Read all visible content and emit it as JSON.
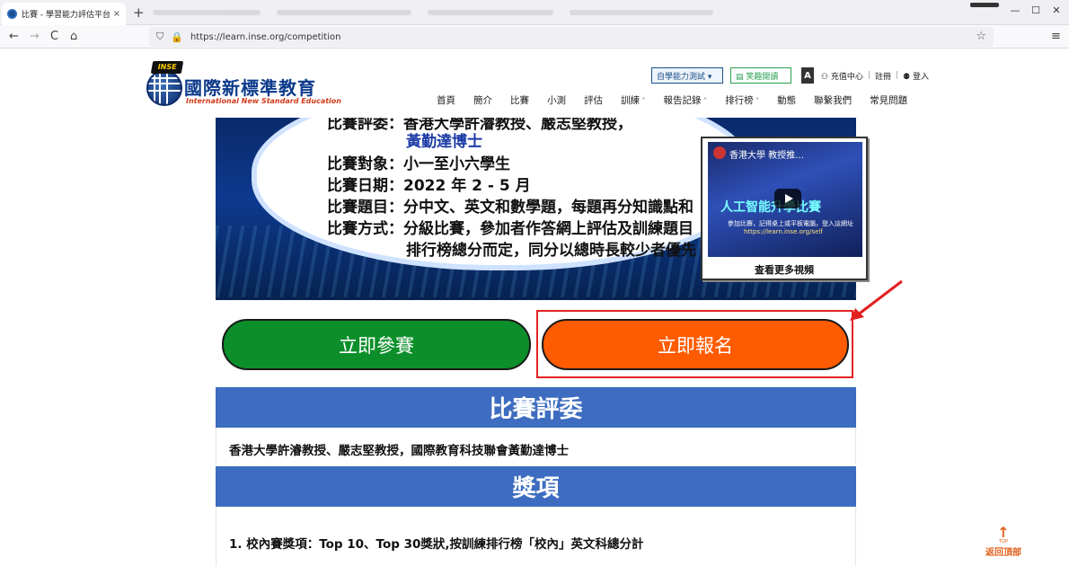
{
  "browser": {
    "tab_title": "比賽 - 學習能力評估平台",
    "tab_close": "×",
    "new_tab": "+",
    "url": "https://learn.inse.org/competition",
    "back": "←",
    "forward": "→",
    "reload": "C",
    "home": "⌂",
    "lock": "🔒",
    "bookmark_star": "☆",
    "menu": "≡",
    "minimize": "—",
    "maximize": "☐",
    "close": "✕"
  },
  "site": {
    "logo_cap_text": "INSE",
    "logo_cn": "國際新標準教育",
    "logo_en": "International New Standard Education",
    "self_test_label": "自學能力測試 ▾",
    "easy_read_label": "▤ 笑趣閱讀",
    "font_size_label": "A",
    "recharge_label": "⚇ 充值中心",
    "register_label": "註冊",
    "separator": "|",
    "login_label": "⚉ 登入",
    "nav": [
      {
        "label": "首頁"
      },
      {
        "label": "簡介"
      },
      {
        "label": "比賽"
      },
      {
        "label": "小測"
      },
      {
        "label": "評估"
      },
      {
        "label": "訓練"
      },
      {
        "label": "報告記錄"
      },
      {
        "label": "排行榜"
      },
      {
        "label": "動態"
      },
      {
        "label": "聯繫我們"
      },
      {
        "label": "常見問題"
      }
    ]
  },
  "banner": {
    "line_judges_partial": "比賽評委：香港大學許濬教授、嚴志堅教授，",
    "line_judges_cont": "黃勤達博士",
    "line_target": "比賽對象：小一至小六學生",
    "line_date": "比賽日期：2022 年 2 - 5 月",
    "line_subjects": "比賽題目：分中文、英文和數學題，每題再分知識點和",
    "line_method": "比賽方式：分級比賽，參加者作答網上評估及訓練題目",
    "line_method_cont": "排行榜總分而定，同分以總時長較少者優先"
  },
  "video": {
    "title": "香港大學 教授推…",
    "big_text": "人工智能升學比賽",
    "line": "參加比賽，記得桌上或平板電腦，登入這網址",
    "url_text": "https://learn.inse.org/self",
    "more_label": "查看更多視頻"
  },
  "actions": {
    "join_label": "立即參賽",
    "register_label": "立即報名"
  },
  "sections": {
    "judges_title": "比賽評委",
    "judges_text": "香港大學許濬教授、嚴志堅教授，國際教育科技聯會黃勤達博士",
    "awards_title": "獎項",
    "awards_item1": "1. 校內賽獎項：Top 10、Top 30獎狀,按訓練排行榜「校內」英文科總分計"
  },
  "back_to_top": {
    "arrow": "↑",
    "small": "TOP",
    "label": "返回頂部"
  },
  "colors": {
    "join": "#0c8f2a",
    "register": "#ff5b00",
    "section_header": "#3d6cc0",
    "highlight": "#e42020"
  }
}
